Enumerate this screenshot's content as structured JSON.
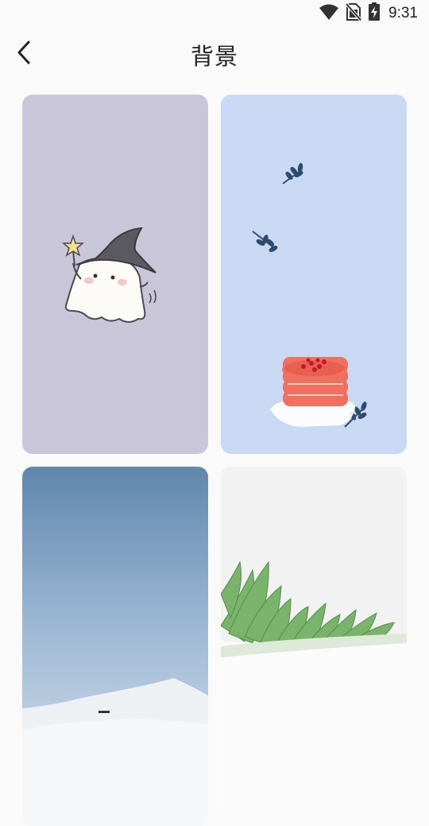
{
  "status_bar": {
    "time": "9:31",
    "icons": [
      "wifi-icon",
      "no-sim-icon",
      "battery-charging-icon"
    ]
  },
  "header": {
    "title": "背景",
    "back_icon": "chevron-left-icon"
  },
  "backgrounds": [
    {
      "name": "ghost-witch",
      "bg_color": "#c9c6d9"
    },
    {
      "name": "pancakes",
      "bg_color": "#c9d9f3"
    },
    {
      "name": "snow-mountain",
      "bg_color": "#8eaacb"
    },
    {
      "name": "green-plant",
      "bg_color": "#f2f2f2"
    }
  ]
}
